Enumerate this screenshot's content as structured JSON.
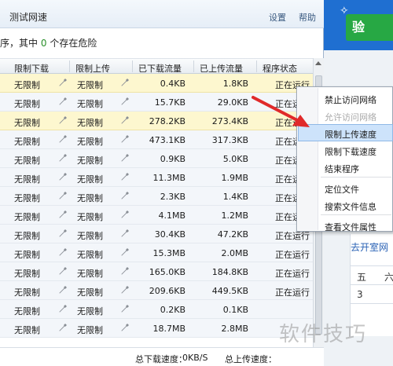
{
  "titlebar": {
    "title": "测试网速",
    "settings": "设置",
    "help": "帮助"
  },
  "infobar": {
    "prefix": "序，其中",
    "count": "0",
    "suffix": "个存在危险"
  },
  "columns": [
    "限制下载",
    "限制上传",
    "已下载流量",
    "已上传流量",
    "程序状态"
  ],
  "rows": [
    {
      "dl_limit": "无限制",
      "ul_limit": "无限制",
      "downloaded": "0.4KB",
      "uploaded": "1.8KB",
      "status": "正在运行",
      "highlight": "yellow"
    },
    {
      "dl_limit": "无限制",
      "ul_limit": "无限制",
      "downloaded": "15.7KB",
      "uploaded": "29.0KB",
      "status": "正在运行",
      "highlight": "none"
    },
    {
      "dl_limit": "无限制",
      "ul_limit": "无限制",
      "downloaded": "278.2KB",
      "uploaded": "273.4KB",
      "status": "正在运行",
      "highlight": "yellow"
    },
    {
      "dl_limit": "无限制",
      "ul_limit": "无限制",
      "downloaded": "473.1KB",
      "uploaded": "317.3KB",
      "status": "正在运行",
      "highlight": "none"
    },
    {
      "dl_limit": "无限制",
      "ul_limit": "无限制",
      "downloaded": "0.9KB",
      "uploaded": "5.0KB",
      "status": "正在运行",
      "highlight": "none"
    },
    {
      "dl_limit": "无限制",
      "ul_limit": "无限制",
      "downloaded": "11.3MB",
      "uploaded": "1.9MB",
      "status": "正在运行",
      "highlight": "none"
    },
    {
      "dl_limit": "无限制",
      "ul_limit": "无限制",
      "downloaded": "2.3KB",
      "uploaded": "1.4KB",
      "status": "正在运行",
      "highlight": "none"
    },
    {
      "dl_limit": "无限制",
      "ul_limit": "无限制",
      "downloaded": "4.1MB",
      "uploaded": "1.2MB",
      "status": "正在运行",
      "highlight": "none"
    },
    {
      "dl_limit": "无限制",
      "ul_limit": "无限制",
      "downloaded": "30.4KB",
      "uploaded": "47.2KB",
      "status": "正在运行",
      "highlight": "none"
    },
    {
      "dl_limit": "无限制",
      "ul_limit": "无限制",
      "downloaded": "15.3MB",
      "uploaded": "2.0MB",
      "status": "正在运行",
      "highlight": "none"
    },
    {
      "dl_limit": "无限制",
      "ul_limit": "无限制",
      "downloaded": "165.0KB",
      "uploaded": "184.8KB",
      "status": "正在运行",
      "highlight": "none"
    },
    {
      "dl_limit": "无限制",
      "ul_limit": "无限制",
      "downloaded": "209.6KB",
      "uploaded": "449.5KB",
      "status": "正在运行",
      "highlight": "none"
    },
    {
      "dl_limit": "无限制",
      "ul_limit": "无限制",
      "downloaded": "0.2KB",
      "uploaded": "0.1KB",
      "status": "",
      "highlight": "none"
    },
    {
      "dl_limit": "无限制",
      "ul_limit": "无限制",
      "downloaded": "18.7MB",
      "uploaded": "2.8MB",
      "status": "",
      "highlight": "none"
    }
  ],
  "statusbar": {
    "download_label": "总下载速度：",
    "download_value": "0KB/S",
    "upload_label": "总上传速度："
  },
  "context_menu": {
    "items": [
      {
        "label": "禁止访问网络",
        "disabled": false,
        "highlighted": false
      },
      {
        "label": "允许访问网络",
        "disabled": true,
        "highlighted": false
      },
      {
        "label": "限制上传速度",
        "disabled": false,
        "highlighted": true
      },
      {
        "label": "限制下载速度",
        "disabled": false,
        "highlighted": false
      },
      {
        "label": "结束程序",
        "disabled": false,
        "highlighted": false
      },
      {
        "label": "定位文件",
        "disabled": false,
        "highlighted": false
      },
      {
        "label": "搜索文件信息",
        "disabled": false,
        "highlighted": false
      },
      {
        "label": "查看文件属性",
        "disabled": false,
        "highlighted": false
      }
    ]
  },
  "background_app": {
    "button_text": "验",
    "link_text": "去开室网",
    "cells": [
      "五",
      "3"
    ],
    "cells_right": [
      "六"
    ]
  },
  "watermark": "软件技巧",
  "colors": {
    "accent_blue": "#1f6fd1",
    "green": "#27a844",
    "row_highlight": "#fdf7cf",
    "menu_highlight": "#cde3fb",
    "arrow_red": "#e02a2a"
  }
}
